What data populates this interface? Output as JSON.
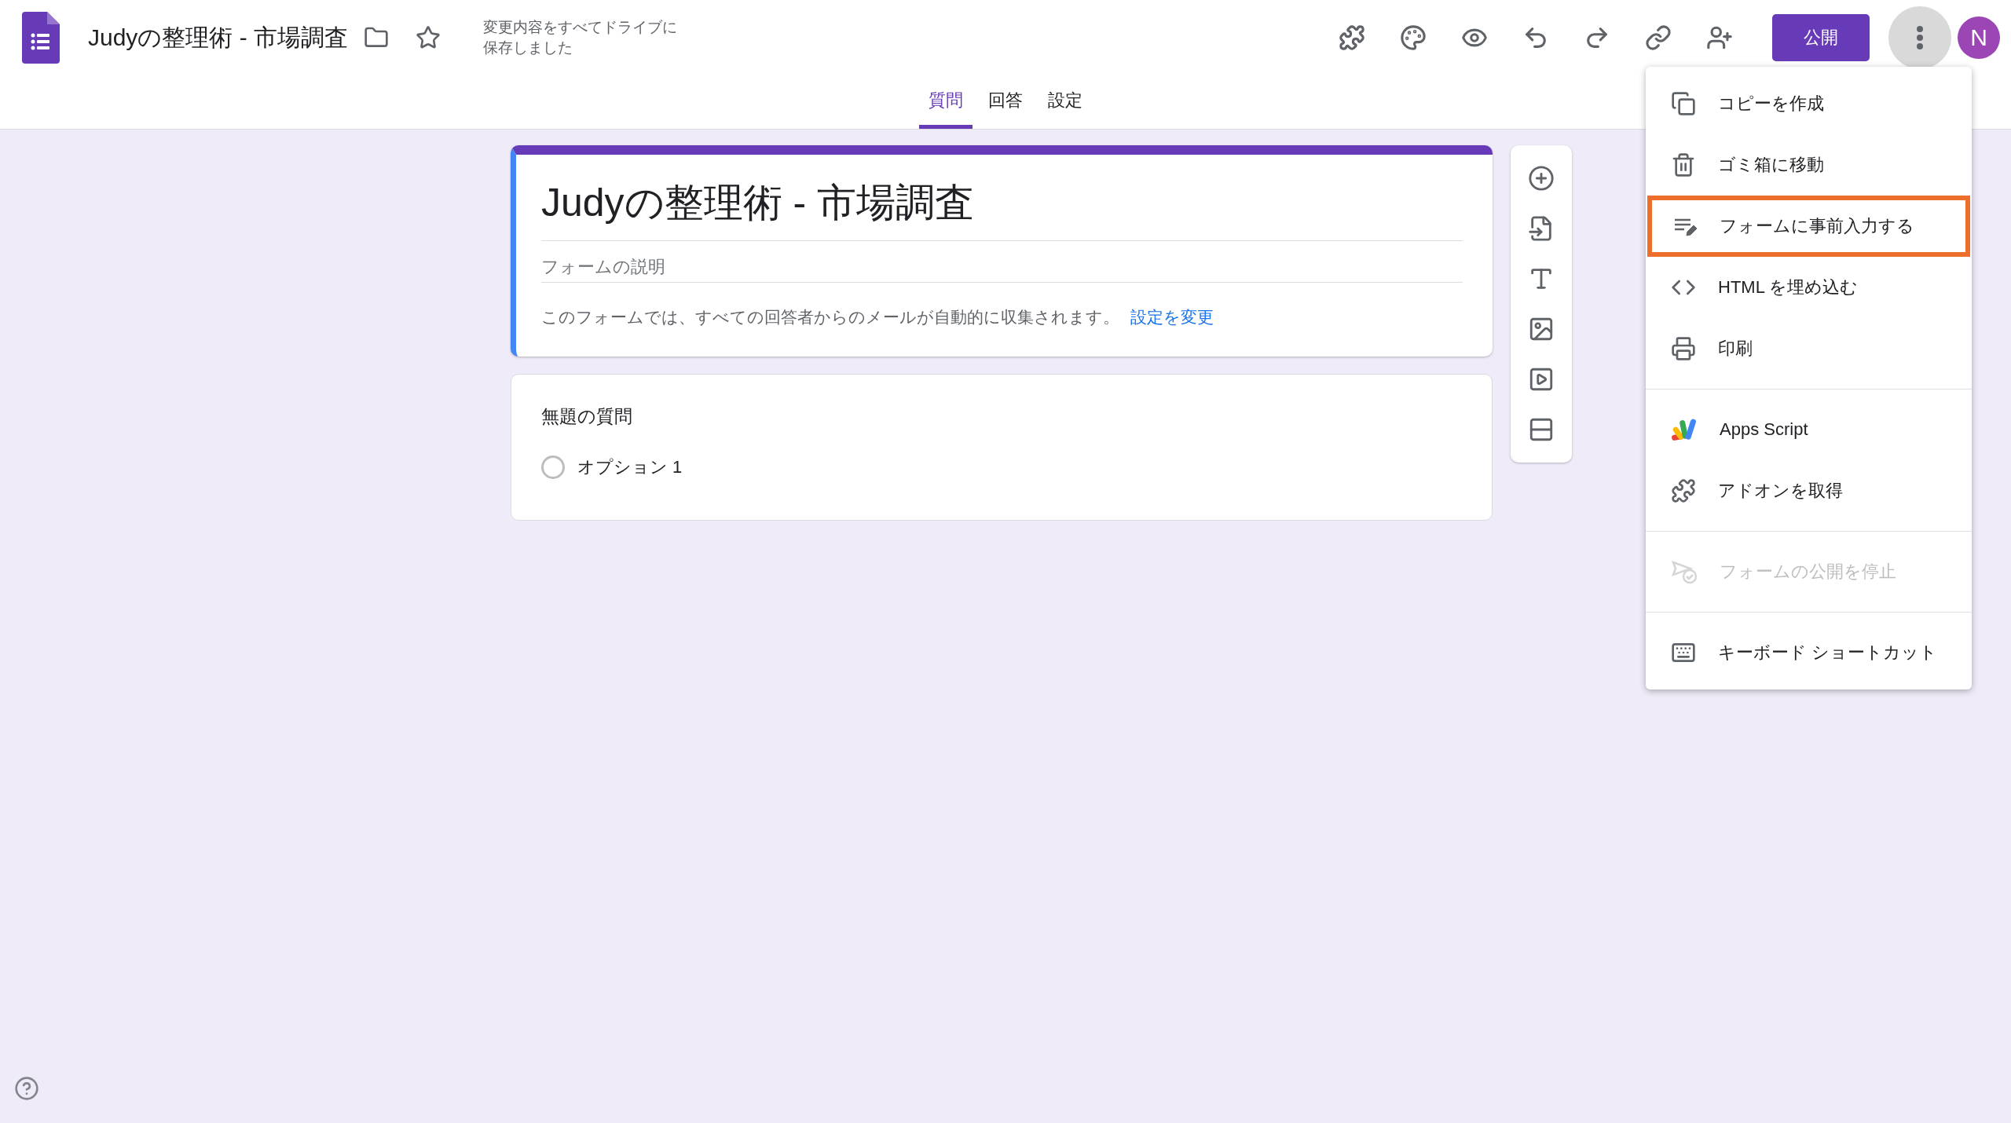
{
  "header": {
    "title": "Judyの整理術 - 市場調査",
    "save_status": "変更内容をすべてドライブに保存しました",
    "publish_button": "公開",
    "avatar": "N",
    "more_pressed": true
  },
  "tabs": [
    {
      "label": "質問",
      "selected": true
    },
    {
      "label": "回答",
      "selected": false
    },
    {
      "label": "設定",
      "selected": false
    }
  ],
  "form": {
    "title": "Judyの整理術 - 市場調査",
    "description_placeholder": "フォームの説明",
    "email_notice": "このフォームでは、すべての回答者からのメールが自動的に収集されます。",
    "email_link": "設定を変更",
    "question": {
      "title": "無題の質問",
      "options": [
        {
          "label": "オプション 1",
          "selected": false
        }
      ]
    }
  },
  "menu": {
    "groups": [
      [
        {
          "label": "コピーを作成",
          "disabled": false,
          "highlighted": false
        },
        {
          "label": "ゴミ箱に移動",
          "disabled": false,
          "highlighted": false
        },
        {
          "label": "フォームに事前入力する",
          "disabled": false,
          "highlighted": true
        },
        {
          "label": "HTML を埋め込む",
          "disabled": false,
          "highlighted": false
        },
        {
          "label": "印刷",
          "disabled": false,
          "highlighted": false
        }
      ],
      [
        {
          "label": "Apps Script",
          "disabled": false,
          "highlighted": false
        },
        {
          "label": "アドオンを取得",
          "disabled": false,
          "highlighted": false
        }
      ],
      [
        {
          "label": "フォームの公開を停止",
          "disabled": true,
          "highlighted": false
        }
      ],
      [
        {
          "label": "キーボード ショートカット",
          "disabled": false,
          "highlighted": false
        }
      ]
    ]
  }
}
